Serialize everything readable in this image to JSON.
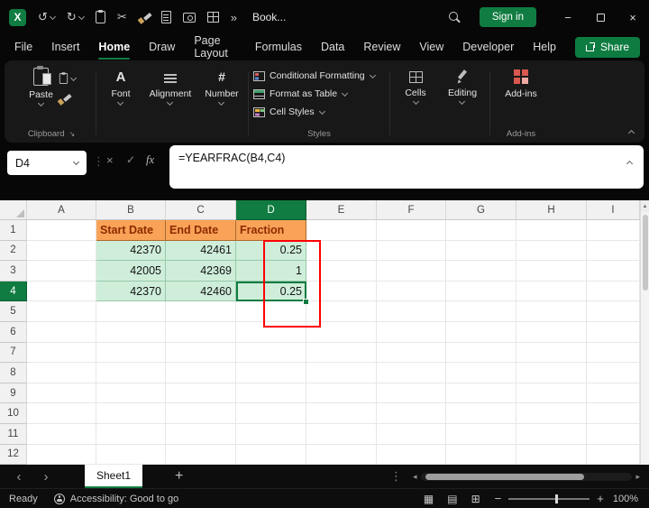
{
  "colors": {
    "accent_green": "#107C41",
    "share_button_green": "#0E7C41",
    "table_header_fill": "#F8A358",
    "table_header_text": "#8E2A00",
    "table_data_fill": "#CFEEDA",
    "annotation_red": "#FF0000"
  },
  "titlebar": {
    "logo_letter": "X",
    "doc_name": "Book...",
    "sign_in_label": "Sign in"
  },
  "glyphs": {
    "undo": "↺",
    "redo": "↻",
    "cut": "✂",
    "overflow": "»",
    "minimize": "−",
    "close": "×",
    "nav_left": "‹",
    "nav_right": "›",
    "add_sheet": "+",
    "ellipsis_v": "⋮",
    "view_normal": "▦",
    "view_page_layout": "▤",
    "view_page_break": "⊞",
    "zoom_out": "−",
    "zoom_in": "+",
    "dialog_launcher": "↘",
    "font_icon_letter": "A",
    "number_icon_symbol": "#",
    "cancel": "×",
    "enter": "✓",
    "scroll_up": "▲",
    "scroll_left": "◂",
    "scroll_right": "▸"
  },
  "menubar": {
    "items": [
      "File",
      "Insert",
      "Home",
      "Draw",
      "Page Layout",
      "Formulas",
      "Data",
      "Review",
      "View",
      "Developer",
      "Help"
    ],
    "active_item": "Home",
    "share_label": "Share"
  },
  "ribbon": {
    "paste_label": "Paste",
    "font_label": "Font",
    "alignment_label": "Alignment",
    "number_label": "Number",
    "conditional_formatting_label": "Conditional Formatting",
    "format_as_table_label": "Format as Table",
    "cell_styles_label": "Cell Styles",
    "cells_label": "Cells",
    "editing_label": "Editing",
    "addins_label": "Add-ins",
    "group_labels": {
      "clipboard": "Clipboard",
      "styles": "Styles",
      "addins": "Add-ins"
    }
  },
  "formula_bar": {
    "name_box_value": "D4",
    "fx_label": "fx",
    "formula": "=YEARFRAC(B4,C4)"
  },
  "sheet": {
    "col_headers": [
      "A",
      "B",
      "C",
      "D",
      "E",
      "F",
      "G",
      "H",
      "I"
    ],
    "row_headers": [
      "1",
      "2",
      "3",
      "4",
      "5",
      "6",
      "7",
      "8",
      "9",
      "10",
      "11",
      "12"
    ],
    "active_cell": "D4",
    "selected_column": "D",
    "selected_row": "4",
    "table": {
      "headers": [
        "Start Date",
        "End Date",
        "Fraction"
      ],
      "rows": [
        [
          "42370",
          "42461",
          "0.25"
        ],
        [
          "42005",
          "42369",
          "1"
        ],
        [
          "42370",
          "42460",
          "0.25"
        ]
      ]
    }
  },
  "sheet_tabs": {
    "active_tab": "Sheet1"
  },
  "status_bar": {
    "mode": "Ready",
    "accessibility_status": "Accessibility: Good to go",
    "zoom_level": "100%"
  }
}
